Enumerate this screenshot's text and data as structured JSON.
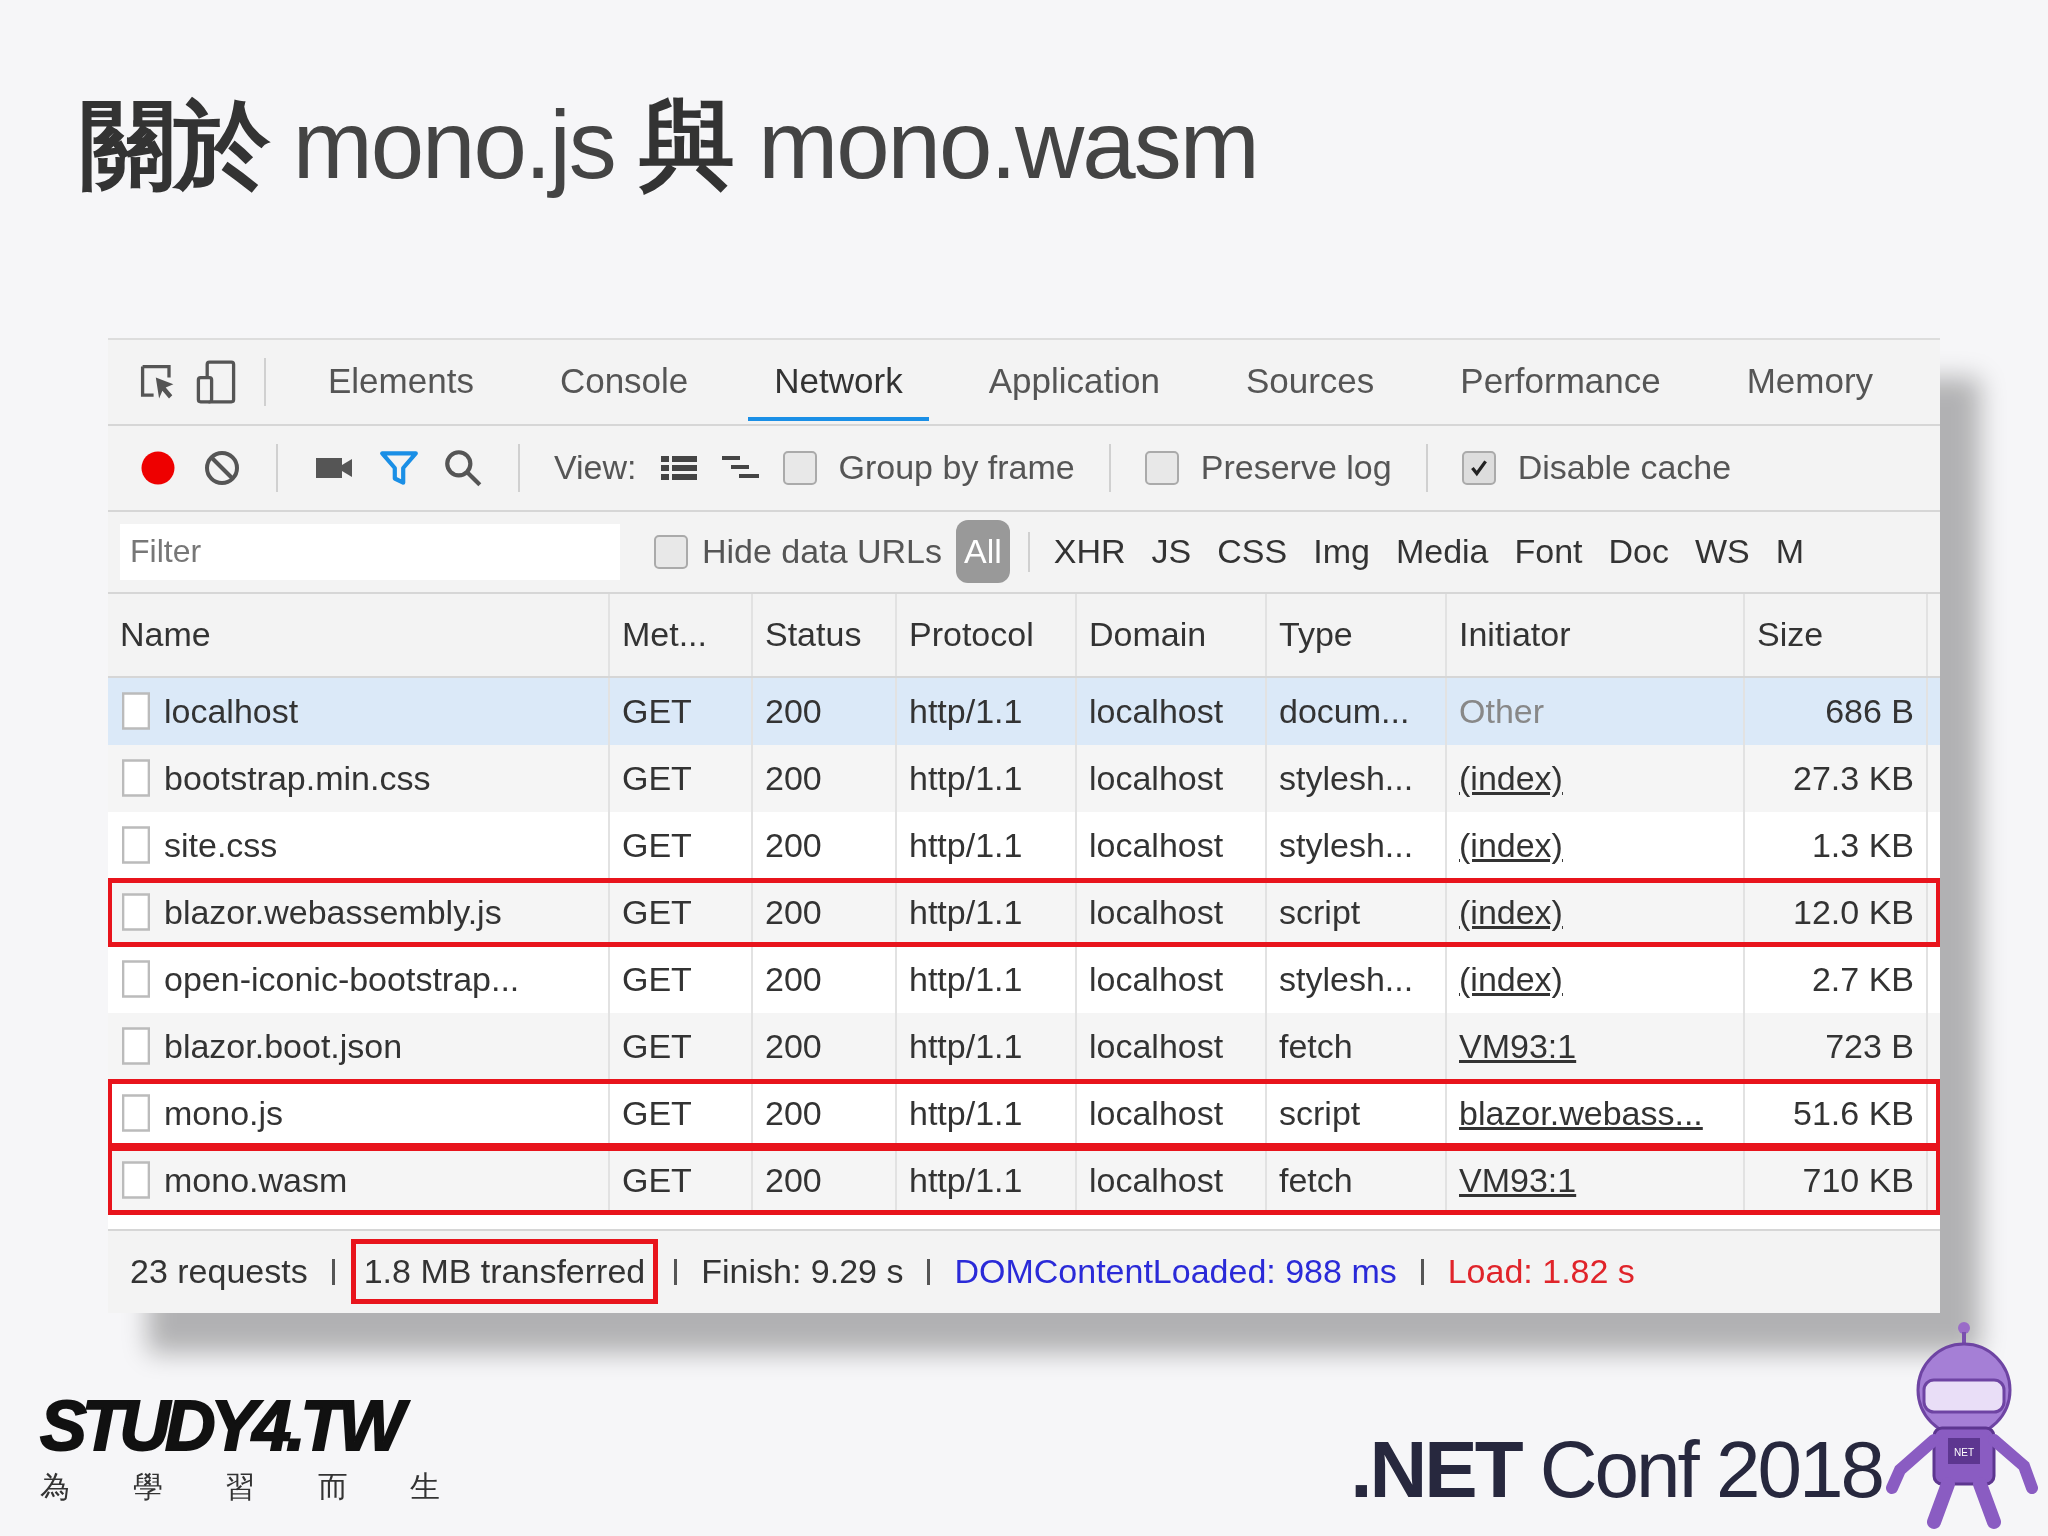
{
  "slide": {
    "title": "**關於** mono.js **與** mono.wasm"
  },
  "devtools": {
    "tabs": [
      {
        "label": "Elements",
        "selected": false
      },
      {
        "label": "Console",
        "selected": false
      },
      {
        "label": "Network",
        "selected": true
      },
      {
        "label": "Application",
        "selected": false
      },
      {
        "label": "Sources",
        "selected": false
      },
      {
        "label": "Performance",
        "selected": false
      },
      {
        "label": "Memory",
        "selected": false
      }
    ],
    "toolbar": {
      "recording": true,
      "filter_active": true,
      "view_label": "View:",
      "checkboxes": [
        {
          "label": "Group by frame",
          "checked": false
        },
        {
          "label": "Preserve log",
          "checked": false
        },
        {
          "label": "Disable cache",
          "checked": true
        }
      ]
    },
    "filter": {
      "placeholder": "Filter",
      "hide_data_urls": {
        "label": "Hide data URLs",
        "checked": false
      },
      "types": [
        {
          "label": "All",
          "selected": true
        },
        {
          "label": "XHR",
          "selected": false
        },
        {
          "label": "JS",
          "selected": false
        },
        {
          "label": "CSS",
          "selected": false
        },
        {
          "label": "Img",
          "selected": false
        },
        {
          "label": "Media",
          "selected": false
        },
        {
          "label": "Font",
          "selected": false
        },
        {
          "label": "Doc",
          "selected": false
        },
        {
          "label": "WS",
          "selected": false
        },
        {
          "label": "M",
          "selected": false
        }
      ]
    },
    "columns": [
      "Name",
      "Met...",
      "Status",
      "Protocol",
      "Domain",
      "Type",
      "Initiator",
      "Size"
    ],
    "rows": [
      {
        "name": "localhost",
        "method": "GET",
        "status": "200",
        "protocol": "http/1.1",
        "domain": "localhost",
        "type": "docum...",
        "initiator": "Other",
        "initiator_link": false,
        "size": "686 B",
        "selected": true,
        "highlighted": false
      },
      {
        "name": "bootstrap.min.css",
        "method": "GET",
        "status": "200",
        "protocol": "http/1.1",
        "domain": "localhost",
        "type": "stylesh...",
        "initiator": "(index)",
        "initiator_link": true,
        "size": "27.3 KB",
        "selected": false,
        "highlighted": false
      },
      {
        "name": "site.css",
        "method": "GET",
        "status": "200",
        "protocol": "http/1.1",
        "domain": "localhost",
        "type": "stylesh...",
        "initiator": "(index)",
        "initiator_link": true,
        "size": "1.3 KB",
        "selected": false,
        "highlighted": false
      },
      {
        "name": "blazor.webassembly.js",
        "method": "GET",
        "status": "200",
        "protocol": "http/1.1",
        "domain": "localhost",
        "type": "script",
        "initiator": "(index)",
        "initiator_link": true,
        "size": "12.0 KB",
        "selected": false,
        "highlighted": true
      },
      {
        "name": "open-iconic-bootstrap...",
        "method": "GET",
        "status": "200",
        "protocol": "http/1.1",
        "domain": "localhost",
        "type": "stylesh...",
        "initiator": "(index)",
        "initiator_link": true,
        "size": "2.7 KB",
        "selected": false,
        "highlighted": false
      },
      {
        "name": "blazor.boot.json",
        "method": "GET",
        "status": "200",
        "protocol": "http/1.1",
        "domain": "localhost",
        "type": "fetch",
        "initiator": "VM93:1",
        "initiator_link": true,
        "size": "723 B",
        "selected": false,
        "highlighted": false
      },
      {
        "name": "mono.js",
        "method": "GET",
        "status": "200",
        "protocol": "http/1.1",
        "domain": "localhost",
        "type": "script",
        "initiator": "blazor.webass...",
        "initiator_link": true,
        "size": "51.6 KB",
        "selected": false,
        "highlighted": true
      },
      {
        "name": "mono.wasm",
        "method": "GET",
        "status": "200",
        "protocol": "http/1.1",
        "domain": "localhost",
        "type": "fetch",
        "initiator": "VM93:1",
        "initiator_link": true,
        "size": "710 KB",
        "selected": false,
        "highlighted": true
      }
    ],
    "status": [
      {
        "text": "23 requests",
        "kind": "plain",
        "highlighted": false
      },
      {
        "text": "1.8 MB transferred",
        "kind": "plain",
        "highlighted": true
      },
      {
        "text": "Finish: 9.29 s",
        "kind": "plain",
        "highlighted": false
      },
      {
        "text": "DOMContentLoaded: 988 ms",
        "kind": "dom",
        "highlighted": false
      },
      {
        "text": "Load: 1.82 s",
        "kind": "load",
        "highlighted": false
      }
    ]
  },
  "footer": {
    "study4_logo": "STUDY4.TW",
    "study4_tagline": [
      "為",
      "學",
      "習",
      "而",
      "生"
    ],
    "conf_title": "**.NET** Conf 2018",
    "bot_badge": "NET"
  }
}
